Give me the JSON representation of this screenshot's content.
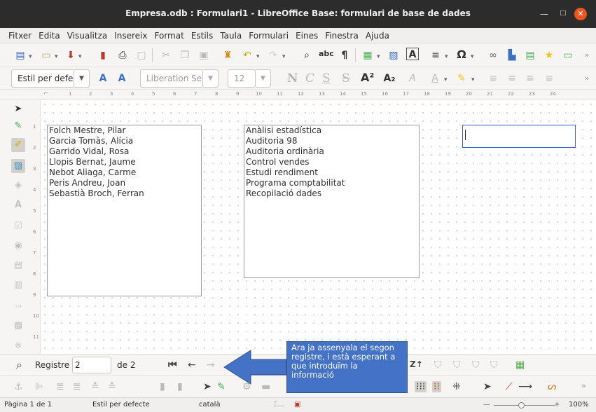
{
  "window": {
    "title": "Empresa.odb : Formulari1 - LibreOffice Base: formulari de base de dades"
  },
  "menu": [
    "Fitxer",
    "Edita",
    "Visualitza",
    "Insereix",
    "Format",
    "Estils",
    "Taula",
    "Formulari",
    "Eines",
    "Finestra",
    "Ajuda"
  ],
  "format_bar": {
    "style": "Estil per defe",
    "font": "Liberation Se",
    "size": "12"
  },
  "ruler_numbers": [
    "1",
    "2",
    "3",
    "4",
    "5",
    "6",
    "7",
    "8",
    "9",
    "10",
    "11",
    "12",
    "13",
    "14",
    "15",
    "16",
    "17",
    "18",
    "19",
    "20",
    "21",
    "22",
    "23",
    "24"
  ],
  "vruler_numbers": [
    "1",
    "2",
    "3",
    "4",
    "5",
    "6",
    "7",
    "8",
    "9",
    "10",
    "11"
  ],
  "listbox_employees": [
    "Folch Mestre, Pilar",
    "Garcia Tomàs, Alícia",
    "Garrido Vidal, Rosa",
    "Llopis Bernat, Jaume",
    "Nebot Aliaga, Carme",
    "Peris Andreu, Joan",
    "Sebastià Broch, Ferran"
  ],
  "listbox_projects": [
    "Anàlisi estadística",
    "Auditoria 98",
    "Auditoria ordinària",
    "Control vendes",
    "Estudi rendiment",
    "Programa comptabilitat",
    "Recopilació dades"
  ],
  "navigation": {
    "record_label": "Registre",
    "record_value": "2",
    "of_label": "de 2"
  },
  "callout": {
    "text": "Ara ja assenyala el segon registre, i està esperant a que introduïm la informació"
  },
  "status": {
    "page": "Pàgina 1 de 1",
    "style": "Estil per defecte",
    "language": "català",
    "zoom": "100%"
  },
  "icons": {
    "left": [
      "pointer-icon",
      "design-mode-icon",
      "control-wizard-icon",
      "form-design-icon",
      "label-icon",
      "text-field-icon",
      "checkbox-icon",
      "option-button-icon",
      "list-box-icon",
      "combo-box-icon",
      "push-button-icon",
      "image-control-icon",
      "more-controls-icon"
    ],
    "colors": {
      "title_bg": "#2c2c2c",
      "close_btn": "#e95420",
      "callout": "#4472c4",
      "selection": "#3e5fd8"
    }
  }
}
